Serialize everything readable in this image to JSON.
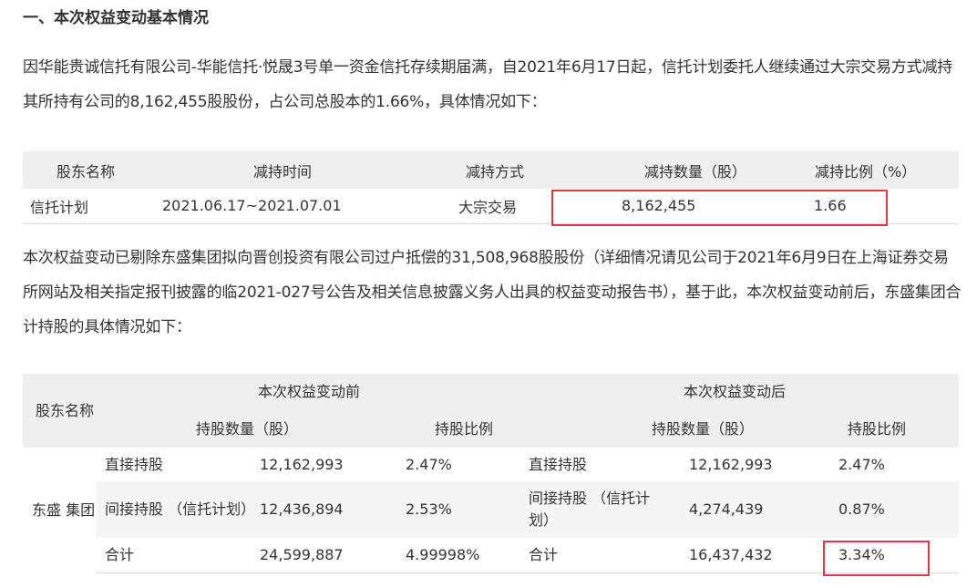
{
  "heading": "一、本次权益变动基本情况",
  "para1": "因华能贵诚信托有限公司-华能信托·悦晟3号单一资金信托存续期届满，自2021年6月17日起，信托计划委托人继续通过大宗交易方式减持其所持有公司的8,162,455股股份，占公司总股本的1.66%，具体情况如下：",
  "table1": {
    "headers": [
      "股东名称",
      "减持时间",
      "减持方式",
      "减持数量（股）",
      "减持比例（%）"
    ],
    "row": [
      "信托计划",
      "2021.06.17~2021.07.01",
      "大宗交易",
      "8,162,455",
      "1.66"
    ]
  },
  "para2": "本次权益变动已剔除东盛集团拟向晋创投资有限公司过户抵偿的31,508,968股股份（详细情况请见公司于2021年6月9日在上海证券交易所网站及相关指定报刊披露的临2021-027号公告及相关信息披露义务人出具的权益变动报告书），基于此，本次权益变动前后，东盛集团合计持股的具体情况如下：",
  "table2": {
    "col_shareholder": "股东名称",
    "before_label": "本次权益变动前",
    "after_label": "本次权益变动后",
    "qty_label": "持股数量（股）",
    "ratio_label": "持股比例",
    "holder": "东盛 集团",
    "rows": [
      {
        "type_before": "直接持股",
        "qty_before": "12,162,993",
        "ratio_before": "2.47%",
        "type_after": "直接持股",
        "qty_after": "12,162,993",
        "ratio_after": "2.47%"
      },
      {
        "type_before": "间接持股 （信托计划）",
        "qty_before": "12,436,894",
        "ratio_before": "2.53%",
        "type_after": "间接持股 （信托计划）",
        "qty_after": "4,274,439",
        "ratio_after": "0.87%"
      },
      {
        "type_before": "合计",
        "qty_before": "24,599,887",
        "ratio_before": "4.99998%",
        "type_after": "合计",
        "qty_after": "16,437,432",
        "ratio_after": "3.34%"
      }
    ]
  },
  "colors": {
    "highlight_border": "#e0383e",
    "header_bg": "#efefef"
  }
}
